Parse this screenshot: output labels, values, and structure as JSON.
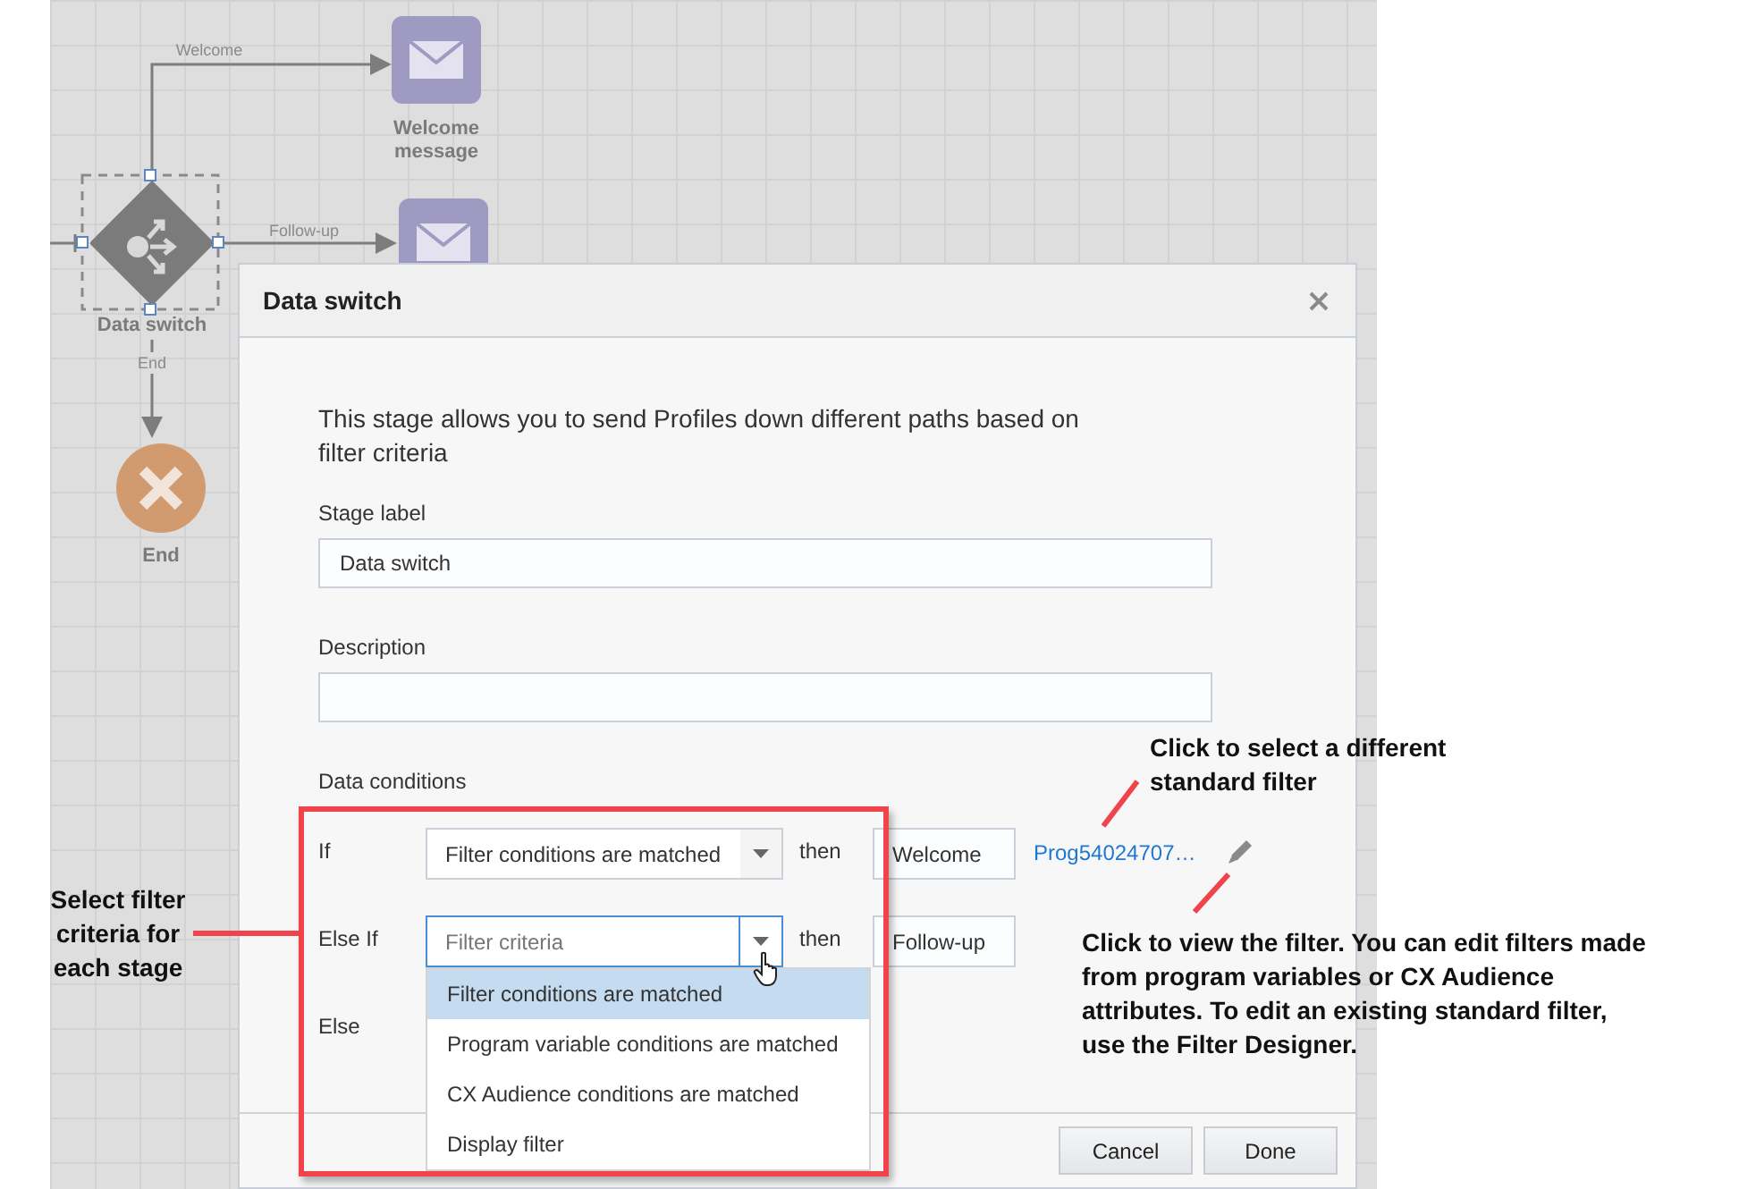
{
  "canvas": {
    "edges": [
      {
        "label": "Welcome"
      },
      {
        "label": "Follow-up"
      },
      {
        "label": "End"
      }
    ],
    "nodes": [
      {
        "kind": "message",
        "label": "Welcome message",
        "selected": false
      },
      {
        "kind": "message"
      },
      {
        "kind": "switch",
        "label": "Data switch",
        "selected": true
      },
      {
        "kind": "end",
        "label": "End",
        "selected": false
      }
    ]
  },
  "dialog": {
    "title": "Data switch",
    "intro": "This stage allows you to send Profiles down different paths based on filter criteria",
    "fields": [
      {
        "label": "Stage label",
        "value": "Data switch"
      },
      {
        "label": "Description"
      }
    ],
    "conditions_label": "Data conditions",
    "conditions": [
      {
        "label": "If",
        "select": {
          "value": "Filter conditions are matched",
          "open": false
        },
        "then": "then",
        "target": "Welcome",
        "filter_link": "Prog54024707…"
      },
      {
        "label": "Else If",
        "select": {
          "placeholder": "Filter criteria",
          "open": true,
          "options": [
            {
              "label": "Filter conditions are matched",
              "selected": true
            },
            {
              "label": "Program variable conditions are matched",
              "selected": false
            },
            {
              "label": "CX Audience conditions are matched",
              "selected": false
            },
            {
              "label": "Display filter",
              "selected": false
            }
          ]
        },
        "then": "then",
        "target": "Follow-up"
      },
      {
        "label": "Else"
      }
    ],
    "buttons": [
      "Cancel",
      "Done"
    ]
  },
  "annotations": [
    {
      "text": "Select filter criteria for each stage"
    },
    {
      "text": "Click to select a different standard filter"
    },
    {
      "text": "Click to view the filter. You can edit filters made from program variables or CX Audience attributes. To edit an existing standard filter, use the Filter Designer."
    }
  ]
}
